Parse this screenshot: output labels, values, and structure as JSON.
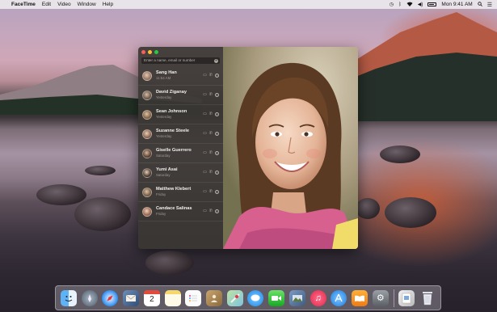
{
  "menubar": {
    "app_name": "FaceTime",
    "menus": [
      "Edit",
      "Video",
      "Window",
      "Help"
    ],
    "clock": "Mon 9:41 AM"
  },
  "facetime": {
    "search_placeholder": "Enter a name, email or number",
    "contacts": [
      {
        "name": "Sang Han",
        "detail": "11:54 AM"
      },
      {
        "name": "David Ziganay",
        "detail": "Yesterday"
      },
      {
        "name": "Sean Johnson",
        "detail": "Yesterday"
      },
      {
        "name": "Suzanne Steele",
        "detail": "Yesterday"
      },
      {
        "name": "Giselle Guerrero",
        "detail": "Saturday"
      },
      {
        "name": "Yumi Asai",
        "detail": "Saturday"
      },
      {
        "name": "Matthew Klebert",
        "detail": "Friday"
      },
      {
        "name": "Candace Salinas",
        "detail": "Friday"
      }
    ],
    "action_video": "▭",
    "action_phone": "✆",
    "action_info": "i"
  },
  "dock": {
    "calendar_day": "2",
    "items": [
      "finder",
      "launchpad",
      "safari",
      "mail-photo",
      "calendar",
      "notes",
      "reminders",
      "contacts",
      "maps",
      "messages",
      "facetime",
      "photos",
      "music",
      "app-store",
      "ibooks",
      "system-preferences",
      "downloads",
      "trash"
    ]
  },
  "colors": {
    "close": "#fd5f57",
    "minimize": "#febc2e",
    "maximize": "#29c840"
  }
}
